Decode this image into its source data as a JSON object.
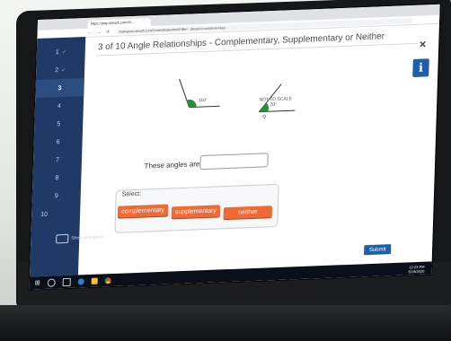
{
  "browser": {
    "tab_title": "https://play.stmath.com/#/...",
    "url": "mathspace.stmath.com/Content/KatexHtml/?title=...&lesson=complementary..."
  },
  "sidebar": {
    "items": [
      {
        "label": "1",
        "done": true
      },
      {
        "label": "2",
        "done": true
      },
      {
        "label": "3",
        "done": false
      },
      {
        "label": "4",
        "done": false
      },
      {
        "label": "5",
        "done": false
      },
      {
        "label": "6",
        "done": false
      },
      {
        "label": "7",
        "done": false
      },
      {
        "label": "8",
        "done": false
      },
      {
        "label": "9",
        "done": false
      },
      {
        "label": "10",
        "done": false
      }
    ],
    "check_glyph": "✓",
    "show_animation": "Show animation"
  },
  "header": {
    "title": "3 of 10 Angle Relationships - Complementary, Supplementary or Neither",
    "close_glyph": "×",
    "info_glyph": "i"
  },
  "figure": {
    "angle1_label": "110°",
    "angle2_label": "70°",
    "angle2_letter": "Q",
    "note": "NOT TO SCALE"
  },
  "question": {
    "prompt": "These angles are",
    "answer_value": ""
  },
  "select": {
    "label": "Select:",
    "options": [
      "complementary",
      "supplementary",
      "neither"
    ]
  },
  "actions": {
    "submit": "Submit"
  },
  "taskbar": {
    "time": "12:23 PM",
    "date": "6/19/2020"
  },
  "colors": {
    "sidebar": "#1f3a66",
    "choice": "#f06a35",
    "primary": "#1f5fa8",
    "angle_fill": "#2a8f3c"
  }
}
